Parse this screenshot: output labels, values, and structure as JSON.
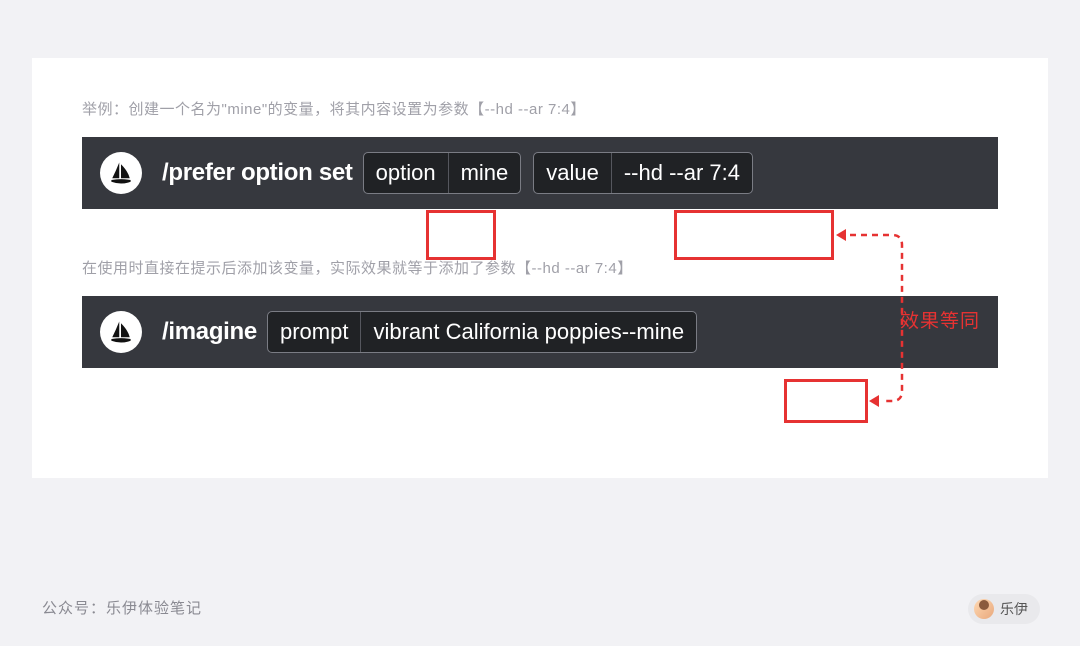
{
  "captions": {
    "top": "举例：创建一个名为\"mine\"的变量，将其内容设置为参数【--hd --ar 7:4】",
    "bottom": "在使用时直接在提示后添加该变量，实际效果就等于添加了参数【--hd --ar 7:4】"
  },
  "bar1": {
    "command": "/prefer option set",
    "group1": {
      "label": "option",
      "value": "mine"
    },
    "group2": {
      "label": "value",
      "value": "--hd --ar 7:4"
    }
  },
  "bar2": {
    "command": "/imagine",
    "group": {
      "label": "prompt",
      "value_main": "vibrant California poppies ",
      "value_suffix": "--mine"
    }
  },
  "equivalence_label": "效果等同",
  "footer": "公众号：乐伊体验笔记",
  "author": "乐伊",
  "icon_name": "midjourney-sailboat-icon",
  "colors": {
    "highlight": "#e63232",
    "discord_bg": "#36383e"
  }
}
